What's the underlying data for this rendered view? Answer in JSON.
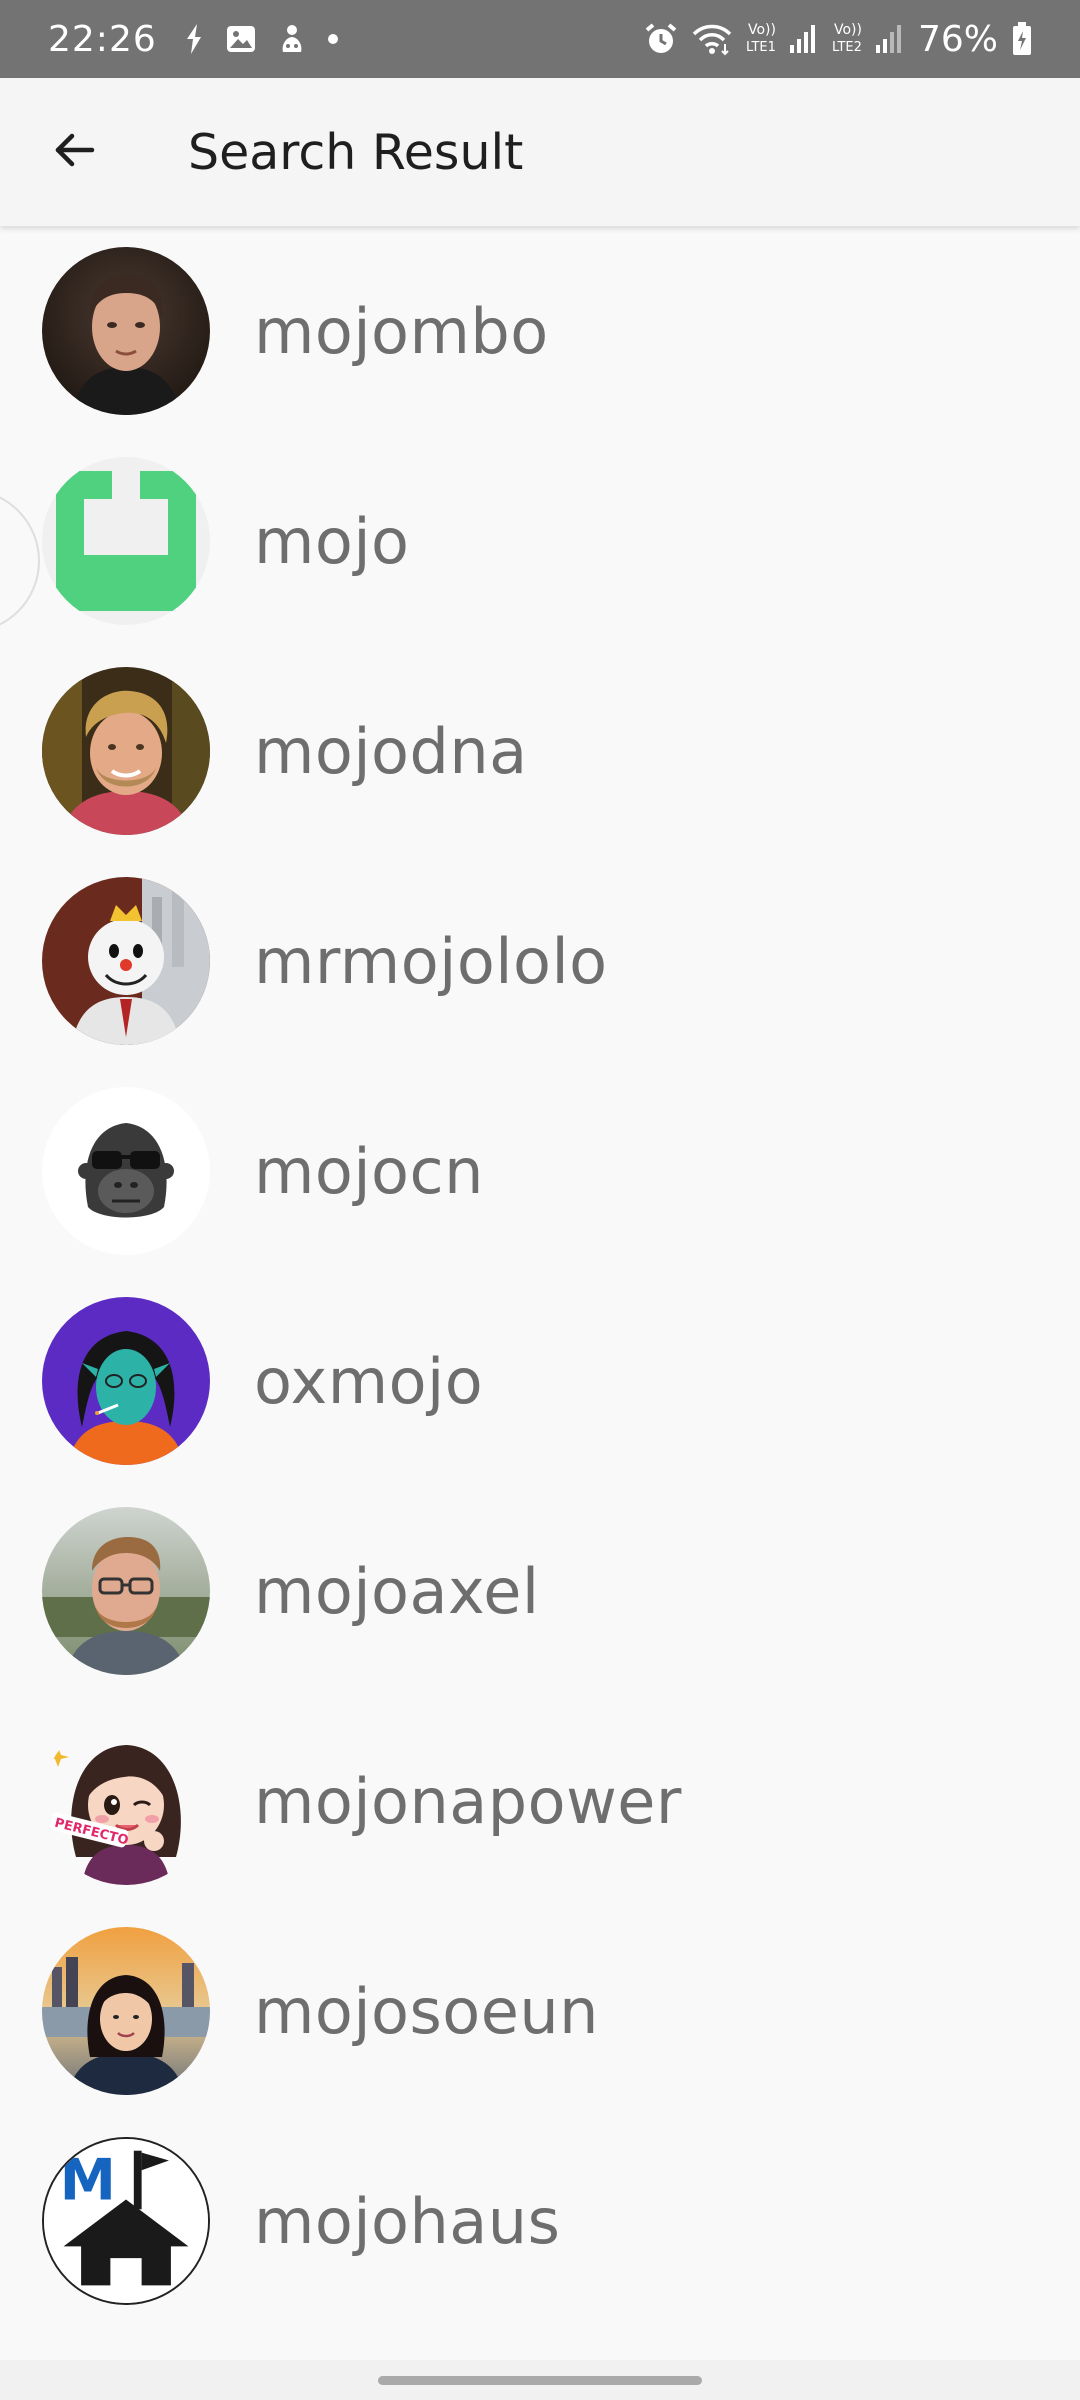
{
  "status_bar": {
    "time": "22:26",
    "battery": "76%",
    "icons": [
      "sync-icon",
      "gallery-icon",
      "game-icon",
      "dot-icon",
      "alarm-icon",
      "wifi-icon",
      "lte1-signal-icon",
      "lte2-signal-icon",
      "battery-charging-icon"
    ],
    "lte1_label_top": "Vo))",
    "lte1_label_bottom": "LTE1",
    "lte2_label_top": "Vo))",
    "lte2_label_bottom": "LTE2"
  },
  "app_bar": {
    "back_icon": "arrow-back-icon",
    "title": "Search Result"
  },
  "results": [
    {
      "username": "mojombo",
      "avatar": "photo-man-dark-hair"
    },
    {
      "username": "mojo",
      "avatar": "green-identicon"
    },
    {
      "username": "mojodna",
      "avatar": "photo-man-blond-beard"
    },
    {
      "username": "mrmojololo",
      "avatar": "jack-mascot"
    },
    {
      "username": "mojocn",
      "avatar": "gorilla-sunglasses"
    },
    {
      "username": "oxmojo",
      "avatar": "blue-character-illustration"
    },
    {
      "username": "mojoaxel",
      "avatar": "photo-man-glasses"
    },
    {
      "username": "mojonapower",
      "avatar": "cartoon-girl-perfecto"
    },
    {
      "username": "mojosoeun",
      "avatar": "photo-woman-sunset"
    },
    {
      "username": "mojohaus",
      "avatar": "mojohaus-logo"
    }
  ],
  "avatar_texts": {
    "perfecto": "PERFECTO",
    "mojohaus_letter": "M"
  },
  "colors": {
    "status_bar_bg": "#737373",
    "app_bar_bg": "#f5f5f5",
    "content_bg": "#f9f9f9",
    "username_text": "#6e6e6e",
    "identicon_green": "#4fd17f",
    "mojohaus_blue": "#1565c0"
  }
}
